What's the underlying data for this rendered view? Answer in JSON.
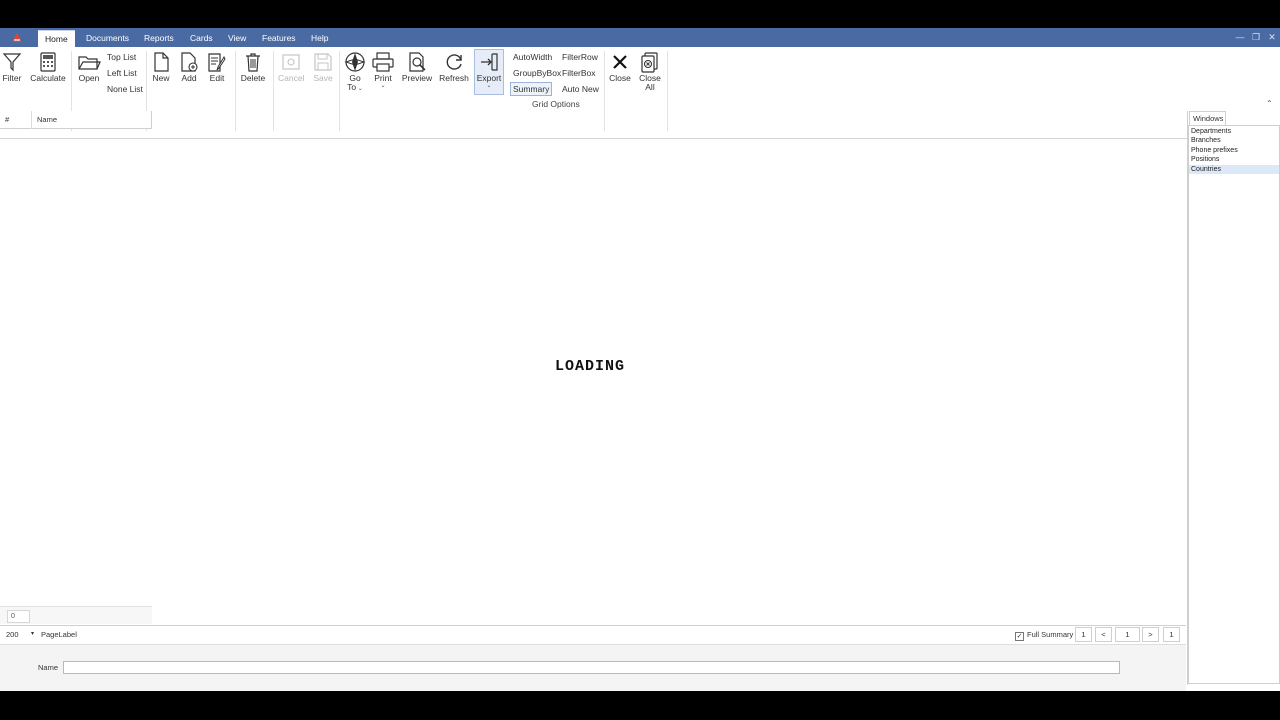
{
  "menu": {
    "tabs": [
      "Home",
      "Documents",
      "Reports",
      "Cards",
      "View",
      "Features",
      "Help"
    ],
    "active": "Home"
  },
  "ribbon": {
    "filter": "Filter",
    "calculate": "Calculate",
    "open": "Open",
    "top_list": "Top List",
    "left_list": "Left List",
    "none_list": "None List",
    "new": "New",
    "add": "Add",
    "edit": "Edit",
    "delete": "Delete",
    "cancel": "Cancel",
    "save": "Save",
    "go_to_1": "Go",
    "go_to_2": "To",
    "print": "Print",
    "preview": "Preview",
    "refresh": "Refresh",
    "export": "Export",
    "autowidth": "AutoWidth",
    "groupbybox": "GroupByBox",
    "summary": "Summary",
    "filterrow": "FilterRow",
    "filterbox": "FilterBox",
    "auto_new": "Auto New",
    "grid_options": "Grid Options",
    "close": "Close",
    "close_all_1": "Close",
    "close_all_2": "All"
  },
  "grid": {
    "col_num": "#",
    "col_name": "Name",
    "loading": "LOADING",
    "footer_count": "0"
  },
  "pager": {
    "page_size": "200",
    "page_label": "PageLabel",
    "full_summary": "Full Summary",
    "first": "1",
    "prev": "<",
    "current": "1",
    "next": ">",
    "last": "1"
  },
  "edit": {
    "name_label": "Name",
    "name_value": ""
  },
  "windows": {
    "tab": "Windows",
    "items": [
      "Departments",
      "Branches",
      "Phone prefixes",
      "Positions",
      "Countries"
    ],
    "selected": "Countries"
  }
}
